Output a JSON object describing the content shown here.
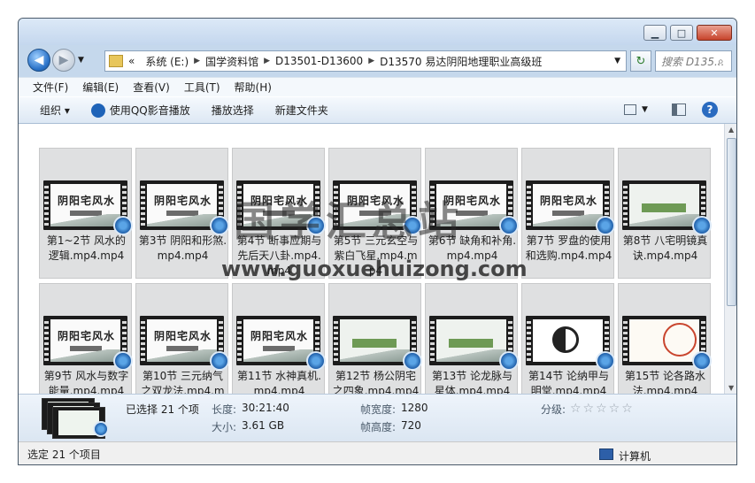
{
  "window": {
    "minimize": "▁",
    "maximize": "□",
    "close": "✕"
  },
  "address": {
    "overflow": "«",
    "crumbs": [
      "系统 (E:)",
      "国学资料馆",
      "D13501-D13600",
      "D13570 易达阴阳地理职业高级班"
    ],
    "search_placeholder": "搜索 D135..."
  },
  "menu": [
    "文件(F)",
    "编辑(E)",
    "查看(V)",
    "工具(T)",
    "帮助(H)"
  ],
  "toolbar": {
    "organize": "组织 ▾",
    "qq_player": "使用QQ影音播放",
    "playlist": "播放选择",
    "new_folder": "新建文件夹"
  },
  "files": [
    {
      "label": "第1~2节 风水的逻辑.mp4.mp4",
      "thumb": "title"
    },
    {
      "label": "第3节 阴阳和形煞.mp4.mp4",
      "thumb": "title"
    },
    {
      "label": "第4节 断事应期与先后天八卦.mp4.mp4",
      "thumb": "title"
    },
    {
      "label": "第5节 三元玄空与紫白飞星.mp4.mp4",
      "thumb": "title"
    },
    {
      "label": "第6节 缺角和补角.mp4.mp4",
      "thumb": "title"
    },
    {
      "label": "第7节 罗盘的使用和选购.mp4.mp4",
      "thumb": "title"
    },
    {
      "label": "第8节 八宅明镜真诀.mp4.mp4",
      "thumb": "alt"
    },
    {
      "label": "第9节 风水与数字能量.mp4.mp4",
      "thumb": "title"
    },
    {
      "label": "第10节 三元纳气之双龙法.mp4.mp4",
      "thumb": "title"
    },
    {
      "label": "第11节 水神真机.mp4.mp4",
      "thumb": "title"
    },
    {
      "label": "第12节 杨公阴宅之四象.mp4.mp4",
      "thumb": "alt"
    },
    {
      "label": "第13节 论龙脉与星体.mp4.mp4",
      "thumb": "alt"
    },
    {
      "label": "第14节 论纳甲与明堂.mp4.mp4",
      "thumb": "bagua"
    },
    {
      "label": "第15节 论各路水法.mp4.mp4",
      "thumb": "chart"
    }
  ],
  "thumb_title_text": "阴阳宅风水",
  "details": {
    "selected": "已选择 21 个项",
    "length_label": "长度:",
    "length_value": "30:21:40",
    "size_label": "大小:",
    "size_value": "3.61 GB",
    "width_label": "帧宽度:",
    "width_value": "1280",
    "height_label": "帧高度:",
    "height_value": "720",
    "rating_label": "分级:",
    "rating_stars": "☆☆☆☆☆"
  },
  "status": {
    "left": "选定 21 个项目",
    "right": "计算机"
  },
  "watermark": {
    "big": "国学汇总站",
    "url": "www.guoxuehuizong.com"
  }
}
